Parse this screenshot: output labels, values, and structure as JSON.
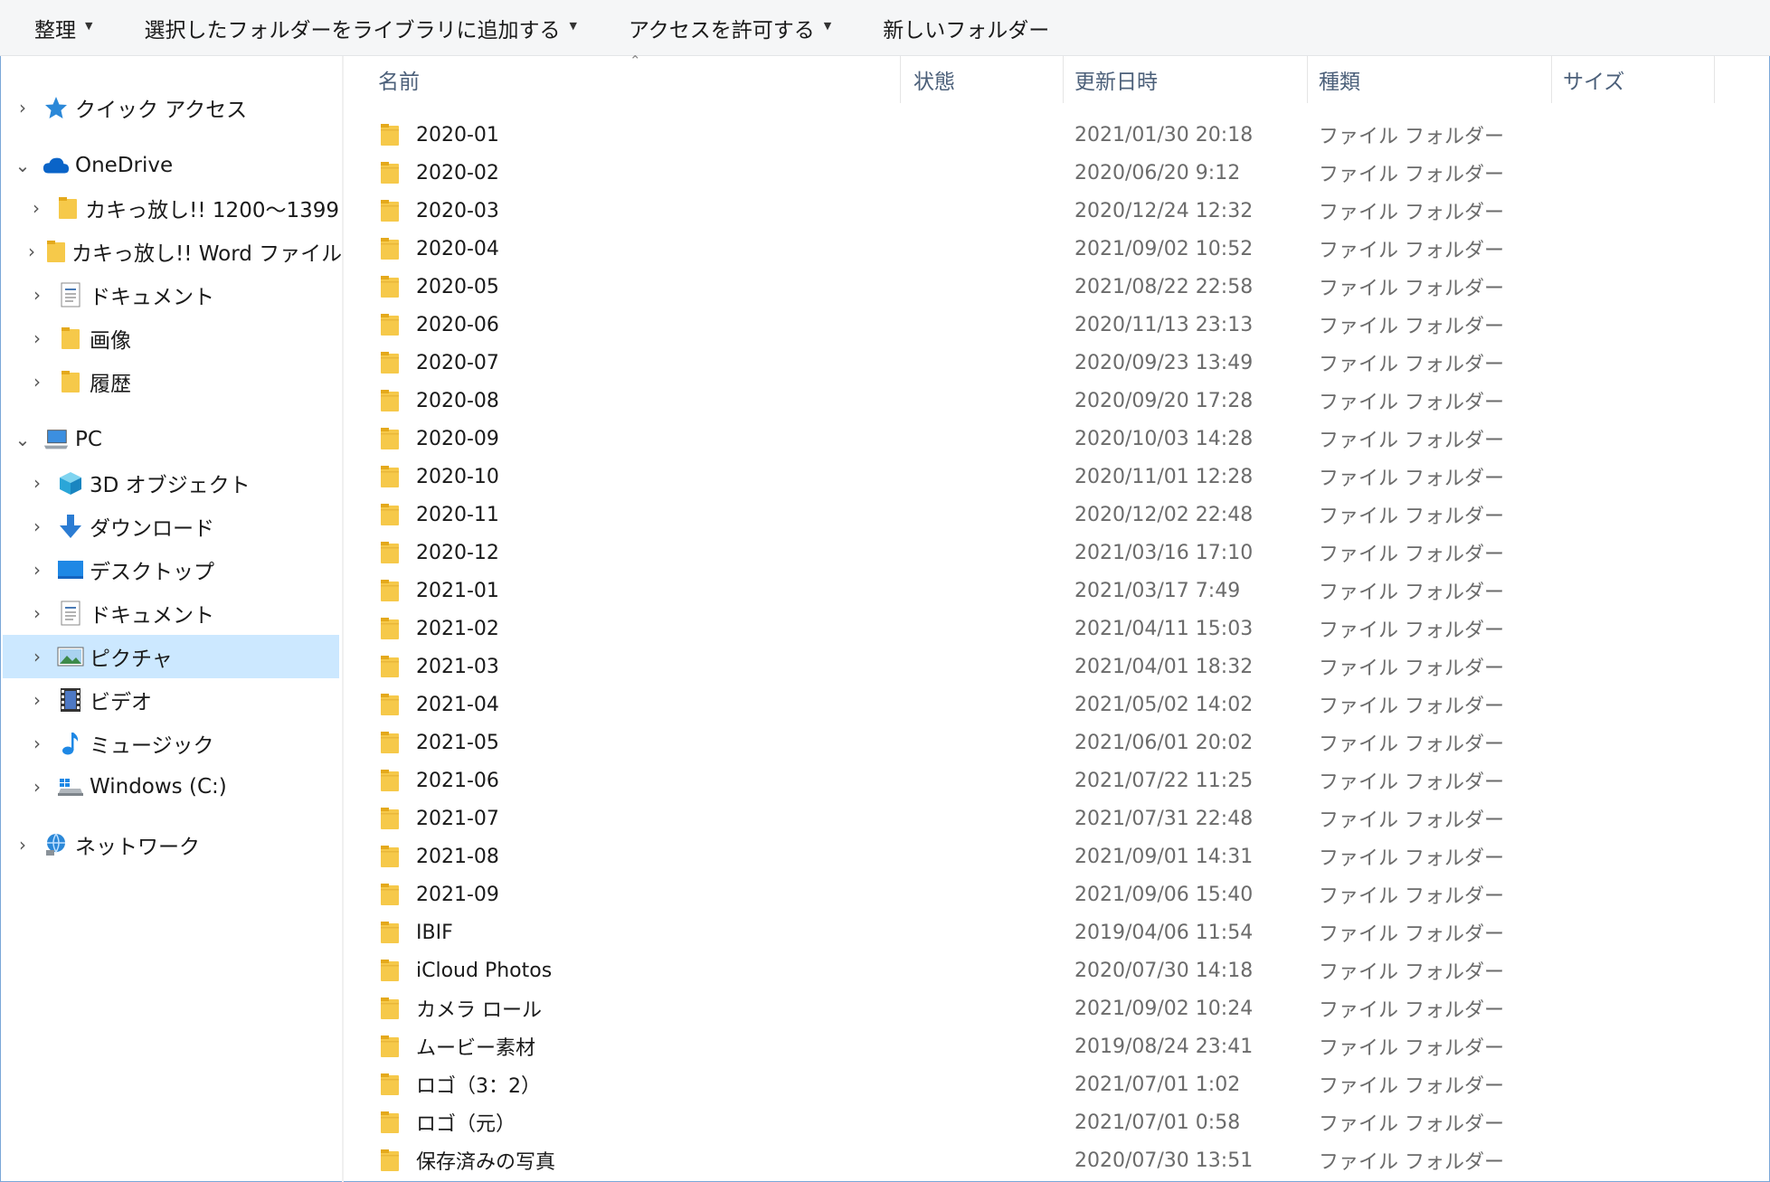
{
  "toolbar": {
    "organize": "整理",
    "add_to_library": "選択したフォルダーをライブラリに追加する",
    "share_access": "アクセスを許可する",
    "new_folder": "新しいフォルダー"
  },
  "nav": {
    "quick_access": "クイック アクセス",
    "onedrive": "OneDrive",
    "od_folder1": "カキっ放し!! 1200〜1399",
    "od_folder2": "カキっ放し!! Word ファイル",
    "od_documents": "ドキュメント",
    "od_images": "画像",
    "od_history": "履歴",
    "pc": "PC",
    "objects3d": "3D オブジェクト",
    "downloads": "ダウンロード",
    "desktop": "デスクトップ",
    "documents": "ドキュメント",
    "pictures": "ピクチャ",
    "videos": "ビデオ",
    "music": "ミュージック",
    "windows_c": "Windows (C:)",
    "network": "ネットワーク",
    "selected": "pictures"
  },
  "columns": {
    "name": "名前",
    "status": "状態",
    "date": "更新日時",
    "type": "種類",
    "size": "サイズ"
  },
  "colors": {
    "selected_bg": "#cce8ff",
    "folder": "#f6c94a",
    "toolbar_bg": "#f5f6f7"
  },
  "rows": [
    {
      "name": "2020-01",
      "date": "2021/01/30 20:18",
      "type": "ファイル フォルダー"
    },
    {
      "name": "2020-02",
      "date": "2020/06/20 9:12",
      "type": "ファイル フォルダー"
    },
    {
      "name": "2020-03",
      "date": "2020/12/24 12:32",
      "type": "ファイル フォルダー"
    },
    {
      "name": "2020-04",
      "date": "2021/09/02 10:52",
      "type": "ファイル フォルダー"
    },
    {
      "name": "2020-05",
      "date": "2021/08/22 22:58",
      "type": "ファイル フォルダー"
    },
    {
      "name": "2020-06",
      "date": "2020/11/13 23:13",
      "type": "ファイル フォルダー"
    },
    {
      "name": "2020-07",
      "date": "2020/09/23 13:49",
      "type": "ファイル フォルダー"
    },
    {
      "name": "2020-08",
      "date": "2020/09/20 17:28",
      "type": "ファイル フォルダー"
    },
    {
      "name": "2020-09",
      "date": "2020/10/03 14:28",
      "type": "ファイル フォルダー"
    },
    {
      "name": "2020-10",
      "date": "2020/11/01 12:28",
      "type": "ファイル フォルダー"
    },
    {
      "name": "2020-11",
      "date": "2020/12/02 22:48",
      "type": "ファイル フォルダー"
    },
    {
      "name": "2020-12",
      "date": "2021/03/16 17:10",
      "type": "ファイル フォルダー"
    },
    {
      "name": "2021-01",
      "date": "2021/03/17 7:49",
      "type": "ファイル フォルダー"
    },
    {
      "name": "2021-02",
      "date": "2021/04/11 15:03",
      "type": "ファイル フォルダー"
    },
    {
      "name": "2021-03",
      "date": "2021/04/01 18:32",
      "type": "ファイル フォルダー"
    },
    {
      "name": "2021-04",
      "date": "2021/05/02 14:02",
      "type": "ファイル フォルダー"
    },
    {
      "name": "2021-05",
      "date": "2021/06/01 20:02",
      "type": "ファイル フォルダー"
    },
    {
      "name": "2021-06",
      "date": "2021/07/22 11:25",
      "type": "ファイル フォルダー"
    },
    {
      "name": "2021-07",
      "date": "2021/07/31 22:48",
      "type": "ファイル フォルダー"
    },
    {
      "name": "2021-08",
      "date": "2021/09/01 14:31",
      "type": "ファイル フォルダー"
    },
    {
      "name": "2021-09",
      "date": "2021/09/06 15:40",
      "type": "ファイル フォルダー"
    },
    {
      "name": "IBIF",
      "date": "2019/04/06 11:54",
      "type": "ファイル フォルダー"
    },
    {
      "name": "iCloud Photos",
      "date": "2020/07/30 14:18",
      "type": "ファイル フォルダー"
    },
    {
      "name": "カメラ ロール",
      "date": "2021/09/02 10:24",
      "type": "ファイル フォルダー"
    },
    {
      "name": "ムービー素材",
      "date": "2019/08/24 23:41",
      "type": "ファイル フォルダー"
    },
    {
      "name": "ロゴ（3：2）",
      "date": "2021/07/01 1:02",
      "type": "ファイル フォルダー"
    },
    {
      "name": "ロゴ（元）",
      "date": "2021/07/01 0:58",
      "type": "ファイル フォルダー"
    },
    {
      "name": "保存済みの写真",
      "date": "2020/07/30 13:51",
      "type": "ファイル フォルダー"
    }
  ]
}
